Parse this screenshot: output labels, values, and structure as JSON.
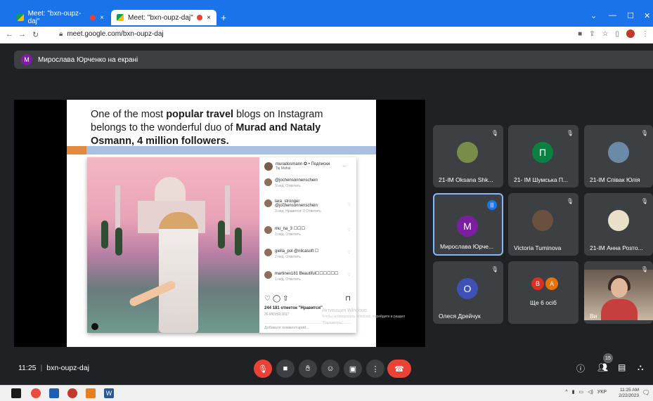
{
  "browser": {
    "tabs": [
      {
        "label": "Meet: \"bxn-oupz-daj\"",
        "close": "×",
        "active": false
      },
      {
        "label": "Meet: \"bxn-oupz-daj\"",
        "close": "×",
        "active": true
      }
    ],
    "new_tab": "+",
    "window_controls": [
      "⌄",
      "—",
      "☐",
      "✕"
    ],
    "url": "meet.google.com/bxn-oupz-daj"
  },
  "presenter_bar": {
    "avatar_letter": "M",
    "text": "Мирослава Юрченко на екрані"
  },
  "slide": {
    "title_html_parts": {
      "p1": "One of the most ",
      "p2": "popular travel",
      "p3": " blogs on Instagram belongs to the wonderful duo of ",
      "p4": "Murad and Nataly Osmann, 4 million followers."
    },
    "instagram": {
      "account": "muradosmann ✪ • Подписки",
      "location": "Taj Mahal",
      "comments": [
        {
          "user": "@jochensonnenschein",
          "meta": "3 нед.   Ответить"
        },
        {
          "user": "lara_stronger",
          "text": "@jochensonnenschein",
          "meta": "3 нед.   Нравится: 3   Ответить"
        },
        {
          "user": "mu_na_3",
          "text": "☐☐☐",
          "meta": "3 нед.   Ответить"
        },
        {
          "user": "giella_pol",
          "text": "@nilcasoft ☐",
          "meta": "2 нед.   Ответить"
        },
        {
          "user": "martinex181",
          "text": "Beautiful☐☐☐☐☐☐",
          "meta": "1 нед.   Ответить"
        }
      ],
      "likes": "244 181 отметок \"Нравится\"",
      "date": "26 ИЮНЯ 2017",
      "add_comment": "Добавьте комментарий..."
    }
  },
  "watermark": {
    "title": "Активация Windows",
    "sub": "Чтобы активировать Windows, перейдите в раздел \"Параметры\"."
  },
  "participants": [
    {
      "name": "21-IM Oksana Shk...",
      "muted": true,
      "avatar": "photo",
      "color": "#7a8c4a"
    },
    {
      "name": "21- IM Шумська П...",
      "muted": true,
      "avatar": "П",
      "color": "#0b8043"
    },
    {
      "name": "21-IM Співак Юлія",
      "muted": true,
      "avatar": "photo",
      "color": "#6a8aa8"
    },
    {
      "name": "Мирослава Юрче...",
      "muted": false,
      "speaking": true,
      "avatar": "M",
      "color": "#7b1fa2"
    },
    {
      "name": "Victoria Tuminova",
      "muted": true,
      "avatar": "photo",
      "color": "#6b5040"
    },
    {
      "name": "21-IM Анна Розто...",
      "muted": true,
      "avatar": "photo",
      "color": "#e8e0c8"
    },
    {
      "name": "Олеся Дрейчук",
      "muted": true,
      "avatar": "О",
      "color": "#3f51b5"
    },
    {
      "more_label": "Ще 6 осіб",
      "letters": [
        "В",
        "А"
      ],
      "colors": [
        "#d93025",
        "#e8710a"
      ]
    },
    {
      "name": "Ви",
      "muted": true,
      "avatar": "camera"
    }
  ],
  "bottom": {
    "time": "11:25",
    "meeting_code": "bxn-oupz-daj",
    "participant_count": "15"
  },
  "taskbar": {
    "lang": "УКР",
    "time": "11:25 AM",
    "date": "2/22/2023"
  }
}
